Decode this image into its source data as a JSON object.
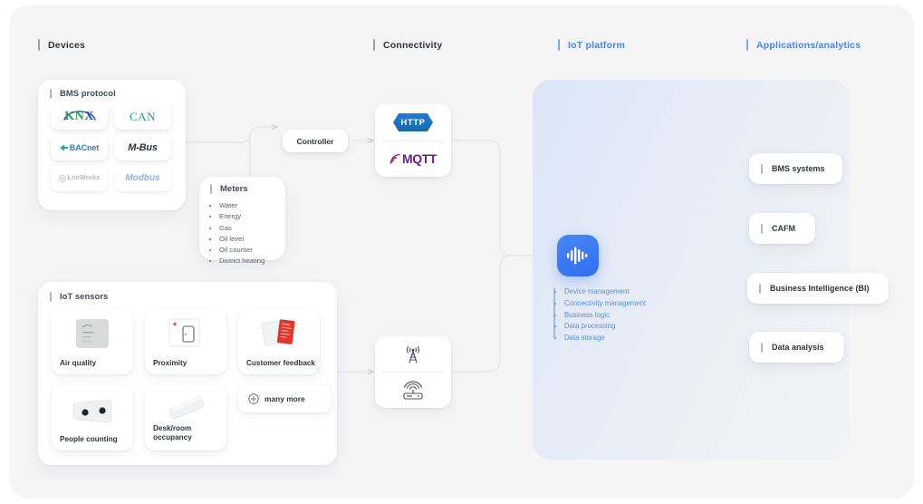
{
  "columns": [
    {
      "label": "Devices",
      "style": "dark"
    },
    {
      "label": "Connectivity",
      "style": "dark"
    },
    {
      "label": "IoT platform",
      "style": "blue"
    },
    {
      "label": "Applications/analytics",
      "style": "blue"
    }
  ],
  "devices": {
    "bms": {
      "title": "BMS protocol",
      "protocols": [
        {
          "name": "KNX",
          "part1": "KN",
          "part2": "X"
        },
        {
          "name": "CAN"
        },
        {
          "name": "BACnet"
        },
        {
          "name": "M-Bus"
        },
        {
          "name": "LonWorks"
        },
        {
          "name": "Modbus"
        }
      ]
    },
    "meters": {
      "title": "Meters",
      "items": [
        "Water",
        "Energy",
        "Gas",
        "Oil level",
        "Oil counter",
        "District heating"
      ]
    },
    "sensors": {
      "title": "IoT sensors",
      "cards": [
        {
          "label": "Air quality",
          "icon": "air-quality-sensor-image"
        },
        {
          "label": "Proximity",
          "icon": "proximity-sensor-image"
        },
        {
          "label": "Customer feedback",
          "icon": "feedback-cards-image"
        },
        {
          "label": "People counting",
          "icon": "people-counter-sensor-image"
        },
        {
          "label": "Desk/room occupancy",
          "icon": "occupancy-sensor-image"
        }
      ],
      "more_label": "many more"
    }
  },
  "connectivity": {
    "controller_label": "Controller",
    "protocols": [
      {
        "label": "HTTP",
        "icon": "http-hexagon-badge"
      },
      {
        "label": "MQTT",
        "icon": "mqtt-logo"
      }
    ],
    "gateways": [
      {
        "icon": "cell-tower-icon"
      },
      {
        "icon": "wireless-router-icon"
      }
    ]
  },
  "platform": {
    "node_icon": "waveform-icon",
    "capabilities": [
      "Device management",
      "Connectivity management",
      "Business logic",
      "Data processing",
      "Data storage"
    ]
  },
  "applications": [
    {
      "label": "BMS systems"
    },
    {
      "label": "CAFM"
    },
    {
      "label": "Business Intelligence (BI)"
    },
    {
      "label": "Data analysis"
    }
  ],
  "colors": {
    "accent_blue": "#4a86f7",
    "platform_text": "#5b8fe0",
    "canvas": "#f5f5f6",
    "knx_green": "#2f9e4f",
    "knx_blue": "#2a56c6",
    "can_green": "#1f9e86",
    "mqtt_purple": "#6b1f8f",
    "http_blue": "#1f7fd0"
  }
}
